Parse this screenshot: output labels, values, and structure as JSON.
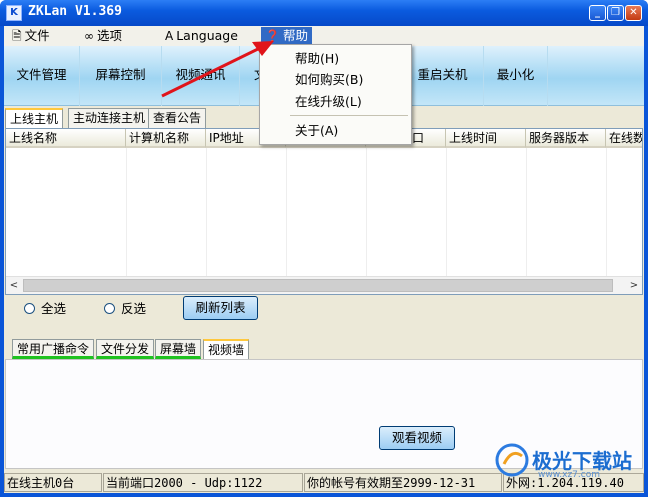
{
  "window": {
    "title": "ZKLan V1.369",
    "app_icon": "K",
    "controls": {
      "minimize": "_",
      "restore": "❐",
      "close": "✕"
    }
  },
  "menubar": {
    "items": [
      {
        "label": "文件",
        "icon": "file-icon"
      },
      {
        "label": "选项",
        "icon": "glasses-icon"
      },
      {
        "label": "Language",
        "icon": "language-icon"
      },
      {
        "label": "帮助",
        "icon": "help-icon",
        "active": true
      }
    ]
  },
  "toolbar": {
    "buttons": [
      "文件管理",
      "屏幕控制",
      "视频通讯",
      "文",
      "重启关机",
      "最小化"
    ]
  },
  "tabs_top": [
    "上线主机",
    "主动连接主机",
    "查看公告"
  ],
  "list": {
    "columns": [
      "上线名称",
      "计算机名称",
      "IP地址",
      "",
      "口",
      "上线时间",
      "服务器版本",
      "在线数"
    ],
    "rows": []
  },
  "controls": {
    "select_all": "全选",
    "invert": "反选",
    "refresh": "刷新列表"
  },
  "tabs_bottom": [
    "常用广播命令",
    "文件分发",
    "屏幕墙",
    "视频墙"
  ],
  "panel": {
    "view_video": "观看视频"
  },
  "status": {
    "online": "在线主机0台",
    "port": "当前端口2000 - Udp:1122",
    "expiry": "你的帐号有效期至2999-12-31",
    "wan": "外网:1.204.119.40"
  },
  "help_menu": {
    "items": [
      "帮助(H)",
      "如何购买(B)",
      "在线升级(L)",
      "关于(A)"
    ]
  },
  "watermark": {
    "text": "极光下载站",
    "url": "www.xz7.com"
  },
  "colors": {
    "titlebar": "#0b5bdf",
    "toolbar": "#9fd5f2",
    "menu_highlight": "#316ac5",
    "tab_underline": "#1fc21f",
    "arrow": "#e0141b"
  }
}
